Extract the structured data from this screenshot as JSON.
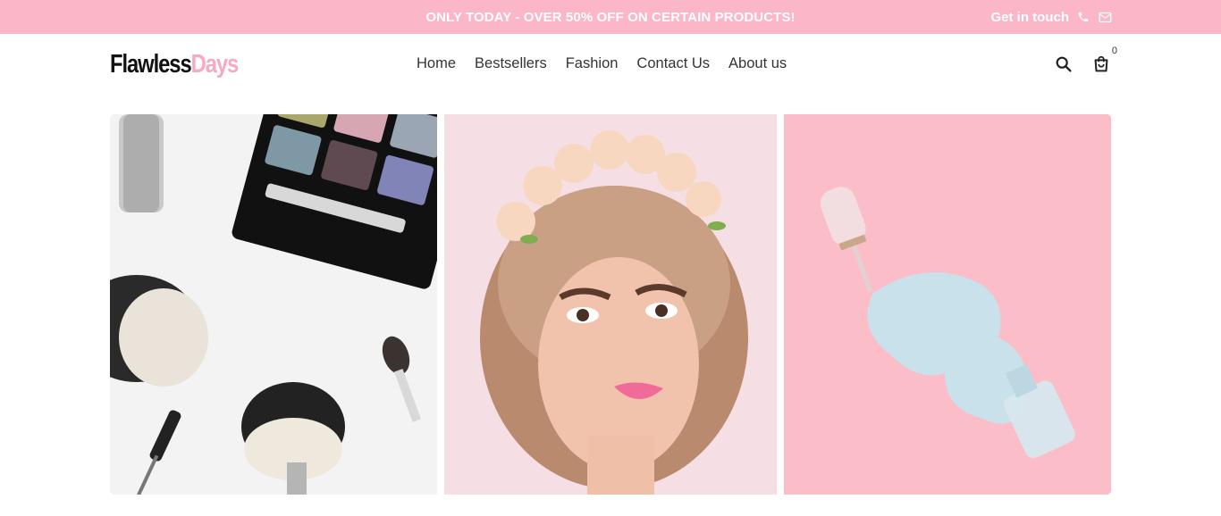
{
  "announcement": {
    "promo_text": "ONLY TODAY - OVER 50% OFF ON CERTAIN PRODUCTS!",
    "contact_label": "Get in touch",
    "icons": [
      "phone-icon",
      "mail-icon"
    ]
  },
  "header": {
    "logo": {
      "part1": "Flawless",
      "part2": "Days"
    },
    "nav": [
      {
        "label": "Home"
      },
      {
        "label": "Bestsellers"
      },
      {
        "label": "Fashion"
      },
      {
        "label": "Contact Us"
      },
      {
        "label": "About us"
      }
    ],
    "cart_count": "0",
    "icons": [
      "search-icon",
      "cart-icon"
    ]
  },
  "gallery": {
    "tiles": [
      "makeup-brushes-and-eyeshadow-palette",
      "woman-with-flower-crown",
      "spilled-nail-polish"
    ]
  },
  "colors": {
    "accent_pink": "#fbb6c8",
    "logo_pink": "#f6a9c0",
    "text_dark": "#333333"
  }
}
